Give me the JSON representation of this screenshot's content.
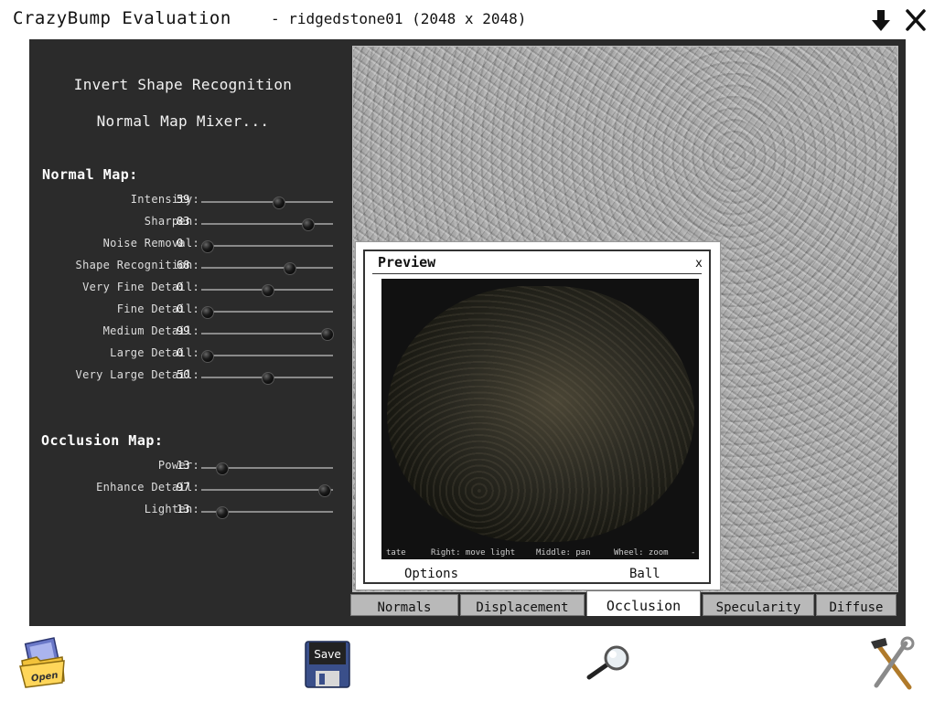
{
  "app_title": "CrazyBump Evaluation",
  "doc_title": "- ridgedstone01 (2048 x 2048)",
  "commands": {
    "invert": "Invert Shape Recognition",
    "mixer": "Normal Map Mixer..."
  },
  "normal_map": {
    "title": "Normal Map:",
    "sliders": [
      {
        "label": "Intensity:",
        "value": "59",
        "level": 59
      },
      {
        "label": "Sharpen:",
        "value": "83",
        "level": 83
      },
      {
        "label": "Noise Removal:",
        "value": "0",
        "level": 0
      },
      {
        "label": "Shape Recognition:",
        "value": "68",
        "level": 68
      },
      {
        "label": "Very Fine Detail:",
        "value": "0",
        "level": 50
      },
      {
        "label": "Fine Detail:",
        "value": "0",
        "level": 0
      },
      {
        "label": "Medium Detail:",
        "value": "99",
        "level": 99
      },
      {
        "label": "Large Detail:",
        "value": "0",
        "level": 0
      },
      {
        "label": "Very Large Detail:",
        "value": "50",
        "level": 50
      }
    ]
  },
  "occlusion_map": {
    "title": "Occlusion Map:",
    "sliders": [
      {
        "label": "Power:",
        "value": "13",
        "level": 12
      },
      {
        "label": "Enhance Detail:",
        "value": "97",
        "level": 97
      },
      {
        "label": "Lighten:",
        "value": "13",
        "level": 12
      }
    ]
  },
  "preview": {
    "title": "Preview",
    "close": "x",
    "hints": [
      "tate",
      "Right: move light",
      "Middle: pan",
      "Wheel: zoom",
      "-"
    ],
    "options_label": "Options",
    "ball_label": "Ball"
  },
  "tabs": [
    {
      "label": "Normals",
      "active": false
    },
    {
      "label": "Displacement",
      "active": false
    },
    {
      "label": "Occlusion",
      "active": true
    },
    {
      "label": "Specularity",
      "active": false
    },
    {
      "label": "Diffuse",
      "active": false
    }
  ],
  "toolbar": {
    "open_label": "Open",
    "save_label": "Save"
  },
  "icons": {
    "download": "download-arrow-icon",
    "close": "close-icon",
    "open": "folder-open-icon",
    "save": "floppy-disk-icon",
    "zoom": "magnifier-icon",
    "settings": "tools-icon"
  }
}
